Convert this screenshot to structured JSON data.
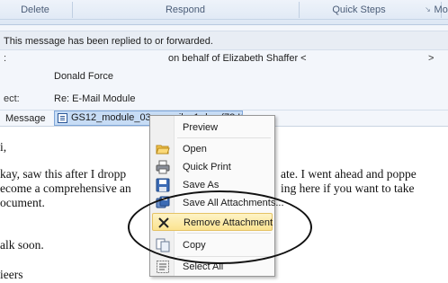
{
  "ribbon": {
    "groups": [
      "Delete",
      "Respond",
      "Quick Steps",
      "Move"
    ],
    "launcher_icon": "dialog-launcher-icon"
  },
  "header": {
    "info_message": "This message has been replied to or forwarded.",
    "from_label": ":",
    "from_value": "on behalf of Elizabeth Shaffer <",
    "from_more": ">",
    "to_value": "Donald Force",
    "subject_label": "ect:",
    "subject_value": "Re: E-Mail Module",
    "message_tab": "Message",
    "attachment_name": "GS12_module_03_e-mail_v1.doc (78 KB)"
  },
  "body": {
    "lines": [
      "i,",
      "kay, saw this after I dropp",
      "ecome a comprehensive an",
      "ocument.",
      "alk soon.",
      "ieers"
    ],
    "fragments": [
      "ate. I went ahead and poppe",
      "ing here if you want to take"
    ]
  },
  "context_menu": {
    "items": [
      {
        "label": "Preview",
        "icon": ""
      },
      {
        "label": "Open",
        "icon": "open-folder-icon"
      },
      {
        "label": "Quick Print",
        "icon": "printer-icon"
      },
      {
        "label": "Save As",
        "icon": "save-icon"
      },
      {
        "label": "Save All Attachments...",
        "icon": "save-all-icon"
      },
      {
        "label": "Remove Attachment",
        "icon": "remove-x-icon"
      },
      {
        "label": "Copy",
        "icon": "copy-icon"
      },
      {
        "label": "Select All",
        "icon": "select-all-icon"
      }
    ],
    "highlighted": "Remove Attachment",
    "highlight_color": "#fbe38f"
  }
}
